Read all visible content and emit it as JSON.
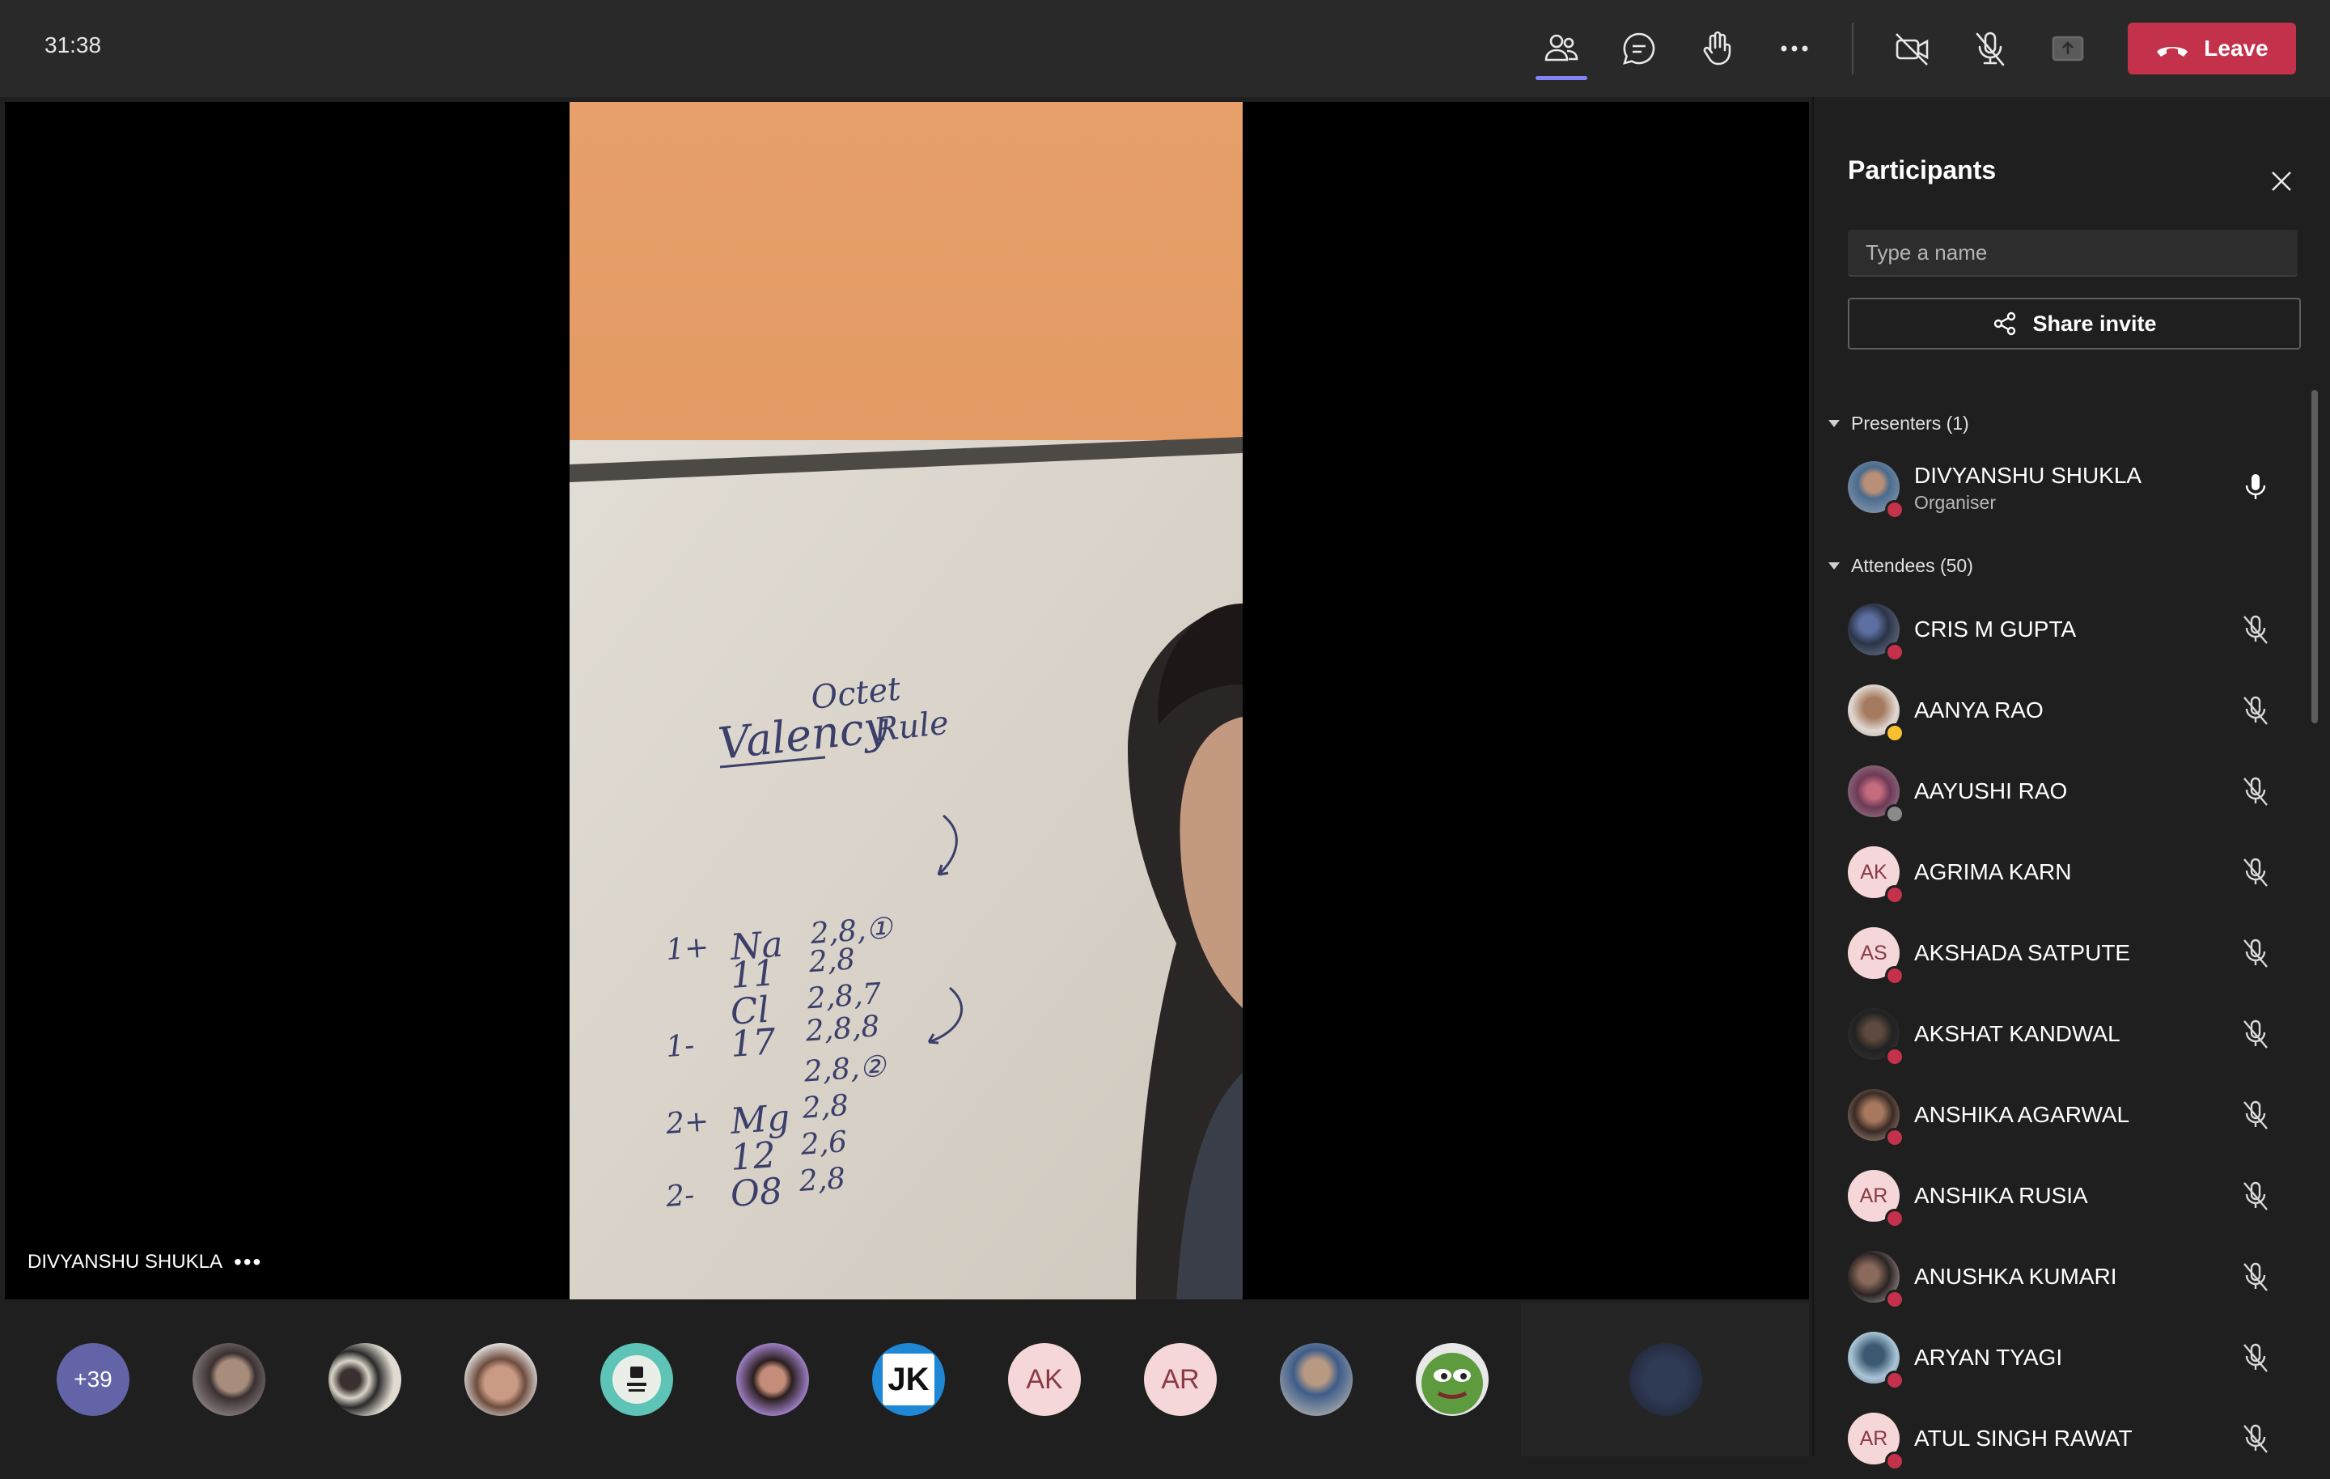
{
  "topbar": {
    "timer": "31:38",
    "leave_label": "Leave",
    "icons": [
      "people-icon",
      "chat-icon",
      "raise-hand-icon",
      "more-icon",
      "camera-off-icon",
      "mic-off-icon",
      "share-tray-icon"
    ]
  },
  "stage": {
    "presenter_label": "DIVYANSHU SHUKLA",
    "more": "•••",
    "whiteboard": {
      "title": "Valency",
      "subtitle_top": "Octet",
      "subtitle": "Rule",
      "lines": [
        {
          "c1": "1+",
          "c2": "Na",
          "c3": "2,8,①"
        },
        {
          "c1": "",
          "c2": "11",
          "c3": "2,8"
        },
        {
          "c1": "",
          "c2": "Cl",
          "c3": "2,8,7"
        },
        {
          "c1": "1-",
          "c2": "17",
          "c3": "2,8,8"
        },
        {
          "c1": "",
          "c2": "",
          "c3": "2,8,②"
        },
        {
          "c1": "2+",
          "c2": "Mg",
          "c3": "2,8"
        },
        {
          "c1": "",
          "c2": "12",
          "c3": "2,6"
        },
        {
          "c1": "2-",
          "c2": "O8",
          "c3": "2,8"
        }
      ]
    }
  },
  "gallery": {
    "overflow_count": "+39",
    "initials": [
      "JK",
      "AK",
      "AR"
    ]
  },
  "panel": {
    "title": "Participants",
    "search_placeholder": "Type a name",
    "share_label": "Share invite",
    "presenters_header": "Presenters (1)",
    "attendees_header": "Attendees (50)",
    "presenter": {
      "name": "DIVYANSHU SHUKLA",
      "role": "Organiser"
    },
    "attendees": [
      {
        "name": "CRIS M GUPTA",
        "initials": "",
        "status": "#c4314b"
      },
      {
        "name": "AANYA RAO",
        "initials": "",
        "status": "#f8c12d"
      },
      {
        "name": "AAYUSHI RAO",
        "initials": "",
        "status": "#8a8a8a"
      },
      {
        "name": "AGRIMA KARN",
        "initials": "AK",
        "status": "#c4314b"
      },
      {
        "name": "AKSHADA SATPUTE",
        "initials": "AS",
        "status": "#c4314b"
      },
      {
        "name": "AKSHAT KANDWAL",
        "initials": "",
        "status": "#c4314b"
      },
      {
        "name": "ANSHIKA AGARWAL",
        "initials": "",
        "status": "#c4314b"
      },
      {
        "name": "ANSHIKA RUSIA",
        "initials": "AR",
        "status": "#c4314b"
      },
      {
        "name": "ANUSHKA KUMARI",
        "initials": "",
        "status": "#c4314b"
      },
      {
        "name": "ARYAN TYAGI",
        "initials": "",
        "status": "#c4314b"
      },
      {
        "name": "ATUL SINGH RAWAT",
        "initials": "AR",
        "status": "#c4314b"
      }
    ]
  },
  "colors": {
    "leave": "#c4314b",
    "accent": "#7f85f5",
    "busy": "#c4314b",
    "away": "#f8c12d"
  }
}
